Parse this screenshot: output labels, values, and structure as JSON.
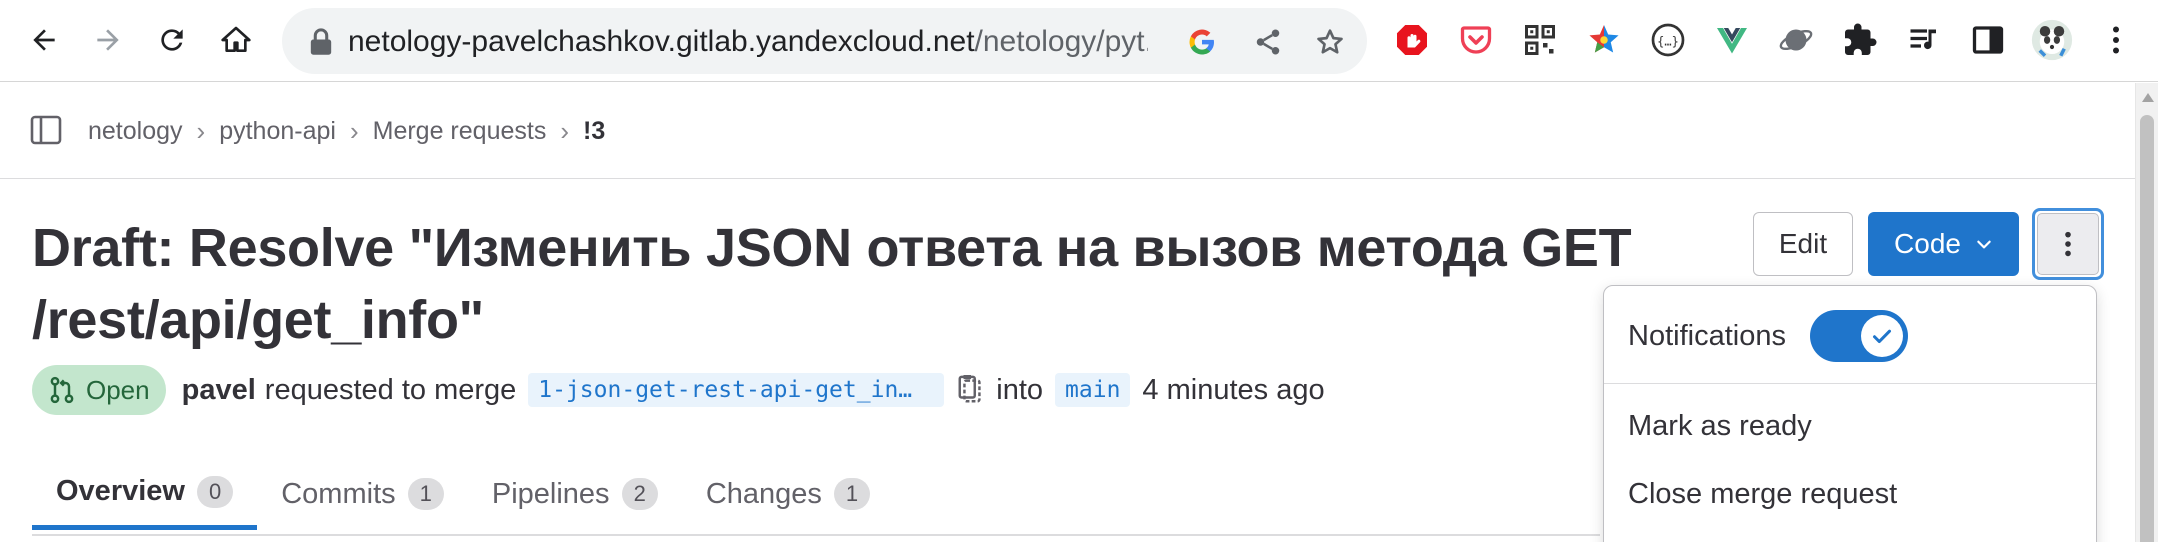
{
  "browser": {
    "url_host": "netology-pavelchashkov.gitlab.yandexcloud.net",
    "url_path": "/netology/pyt...",
    "icons": [
      "back-icon",
      "forward-icon",
      "reload-icon",
      "home-icon",
      "lock-icon",
      "google-icon",
      "share-icon",
      "bookmark-star-icon"
    ],
    "extensions": [
      "adblock-icon",
      "pocket-icon",
      "qr-code-icon",
      "color-star-icon",
      "json-viewer-icon",
      "vue-devtools-icon",
      "planet-icon",
      "puzzle-extensions-icon",
      "media-queue-icon",
      "side-panel-icon",
      "profile-avatar",
      "browser-menu-icon"
    ]
  },
  "breadcrumb": {
    "items": [
      "netology",
      "python-api",
      "Merge requests"
    ],
    "current": "!3"
  },
  "merge_request": {
    "title": "Draft: Resolve \"Изменить JSON ответа на вызов метода GET /rest/api/get_info\"",
    "status": "Open",
    "author": "pavel",
    "action_text": "requested to merge",
    "source_branch": "1-json-get-rest-api-get_in…",
    "into_text": "into",
    "target_branch": "main",
    "time": "4 minutes ago"
  },
  "actions": {
    "edit_label": "Edit",
    "code_label": "Code"
  },
  "tabs": [
    {
      "label": "Overview",
      "count": "0"
    },
    {
      "label": "Commits",
      "count": "1"
    },
    {
      "label": "Pipelines",
      "count": "2"
    },
    {
      "label": "Changes",
      "count": "1"
    }
  ],
  "dropdown": {
    "notifications_label": "Notifications",
    "notifications_on": true,
    "mark_ready_label": "Mark as ready",
    "close_label": "Close merge request"
  },
  "colors": {
    "accent": "#1f75cb",
    "status_bg": "#c3e6cd",
    "status_text": "#24663b"
  }
}
